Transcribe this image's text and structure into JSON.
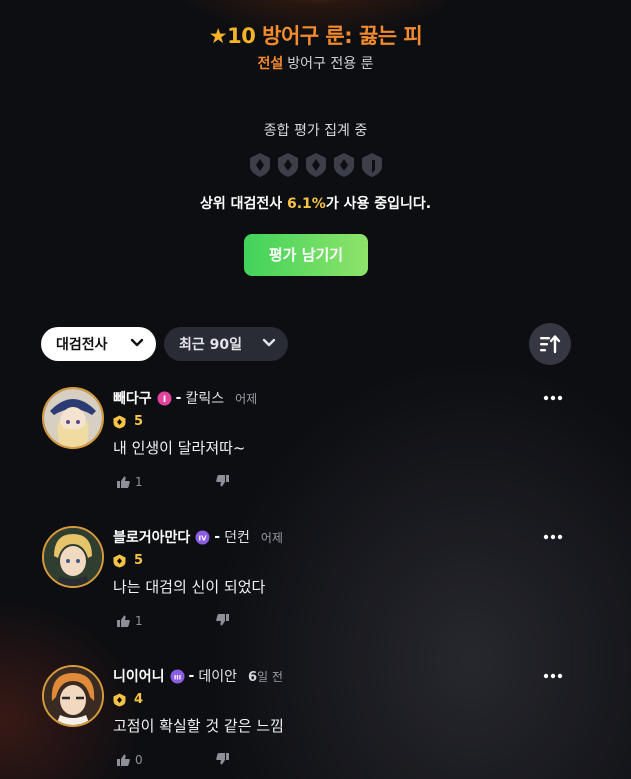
{
  "header": {
    "star": "★10",
    "title": "방어구 룬: 끓는 피",
    "grade": "전설",
    "subtitle": "방어구 전용 룬"
  },
  "evaluation": {
    "status": "종합 평가 집계 중",
    "usage_prefix": "상위 대검전사 ",
    "usage_pct": "6.1%",
    "usage_suffix": "가 사용 중입니다.",
    "button_label": "평가 남기기"
  },
  "filters": {
    "class_label": "대검전사",
    "period_label": "최근 90일",
    "sort_icon": "sort-up-icon"
  },
  "colors": {
    "accent_orange": "#f28a2e",
    "rating_gold": "#f6c445",
    "button_green": "#41d35a"
  },
  "comments": [
    {
      "username": "빼다구",
      "rank_badge": "I",
      "rank_color": "#e0449c",
      "role": "칼릭스",
      "time_num": "",
      "time": "어제",
      "rating": "5",
      "text": "내 인생이 달라져따~",
      "likes": "1"
    },
    {
      "username": "블로거아만다",
      "rank_badge": "IV",
      "rank_color": "#8a5ce0",
      "role": "던컨",
      "time_num": "",
      "time": "어제",
      "rating": "5",
      "text": "나는 대검의 신이 되었다",
      "likes": "1"
    },
    {
      "username": "니이어니",
      "rank_badge": "III",
      "rank_color": "#8a5ce0",
      "role": "데이안",
      "time_num": "6",
      "time": "일 전",
      "rating": "4",
      "text": "고점이 확실할 것 같은 느낌",
      "likes": "0"
    }
  ]
}
